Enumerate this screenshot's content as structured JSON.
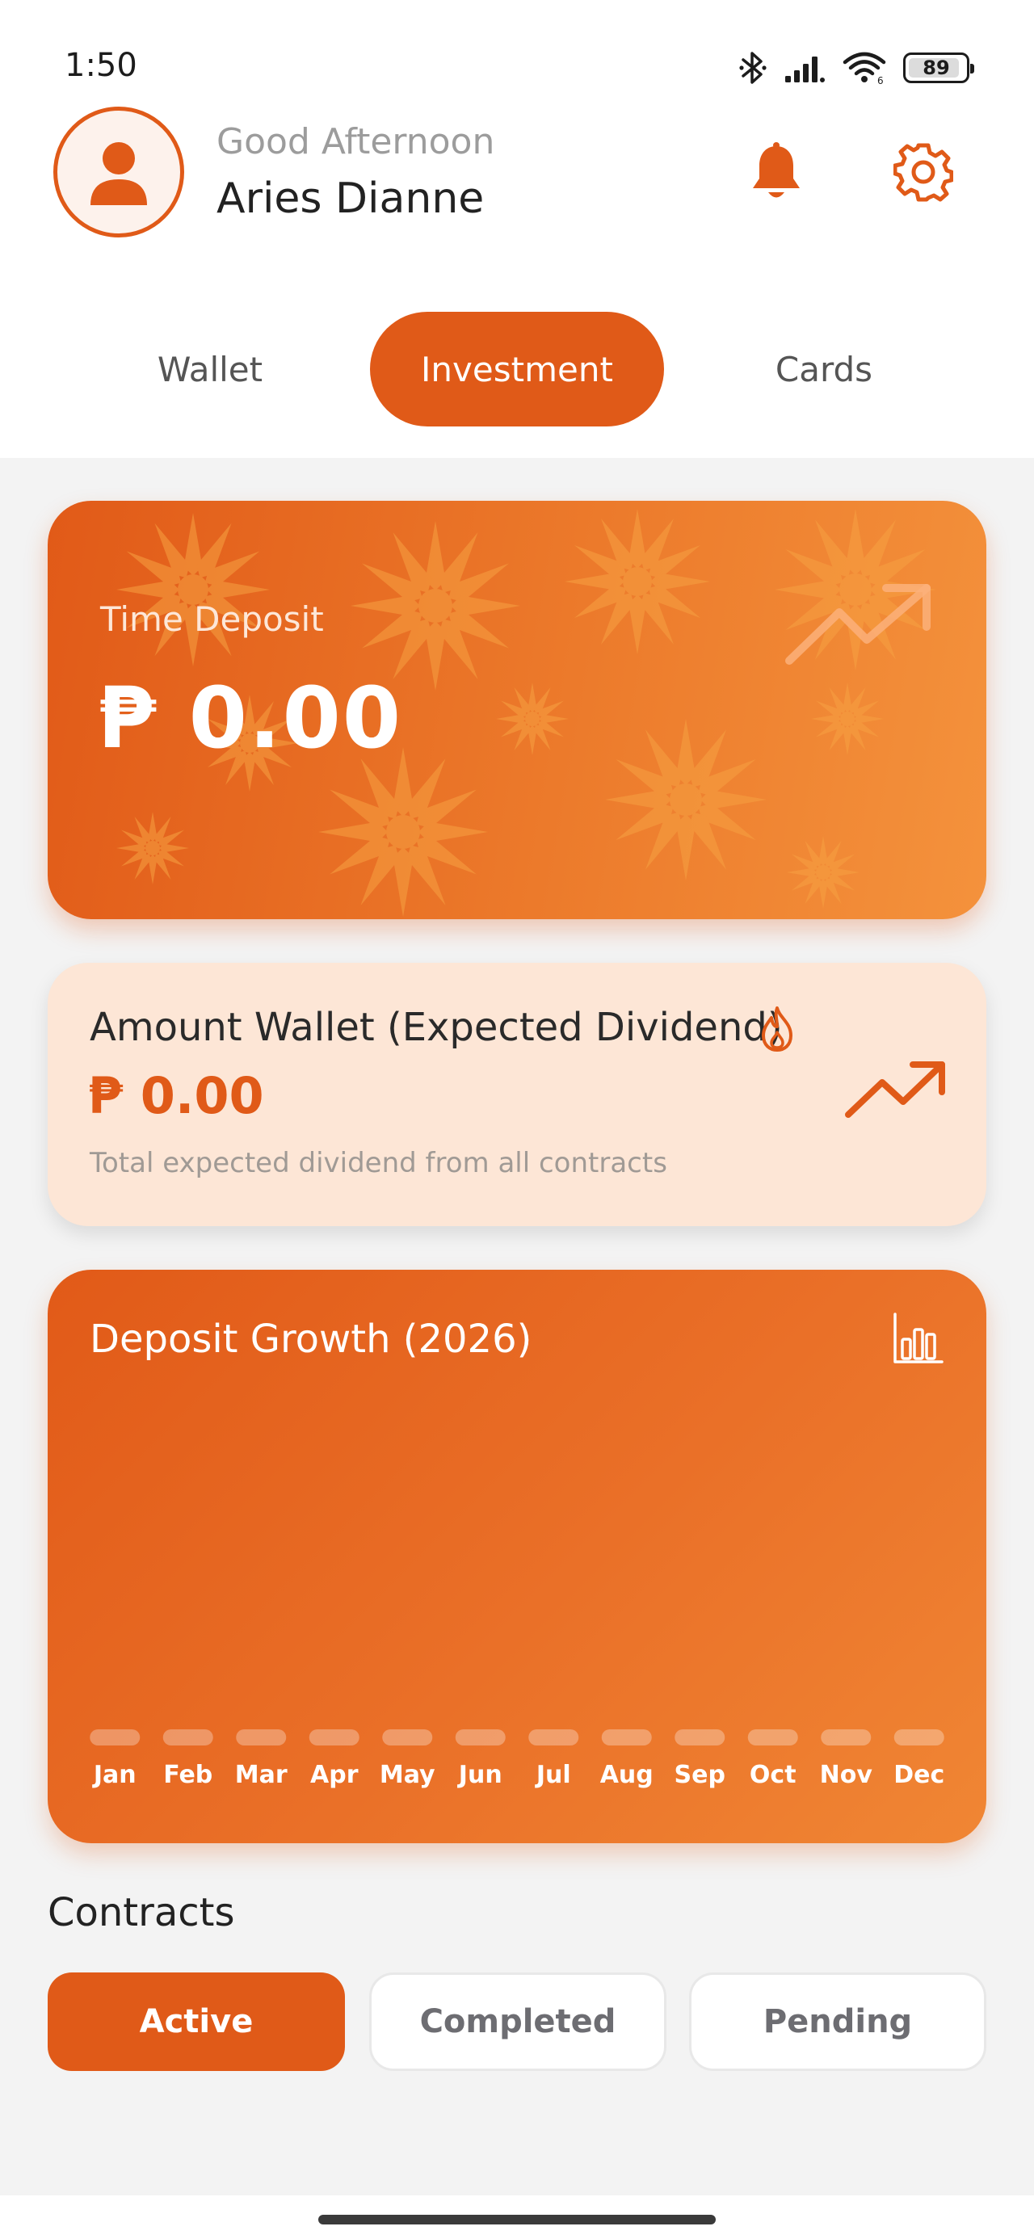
{
  "status_bar": {
    "time": "1:50",
    "battery": "89",
    "icons": [
      "bluetooth-icon",
      "signal-icon",
      "wifi-icon",
      "battery-icon"
    ]
  },
  "header": {
    "greeting": "Good Afternoon",
    "user_name": "Aries Dianne",
    "icons": [
      "user-avatar-icon",
      "bell-icon",
      "gear-icon"
    ]
  },
  "tabs": [
    {
      "label": "Wallet",
      "active": false
    },
    {
      "label": "Investment",
      "active": true
    },
    {
      "label": "Cards",
      "active": false
    }
  ],
  "time_deposit": {
    "label": "Time Deposit",
    "amount": "₱ 0.00"
  },
  "dividend": {
    "title": "Amount Wallet (Expected Dividend)",
    "amount": "₱ 0.00",
    "subtitle": "Total expected dividend from all contracts"
  },
  "growth_chart": {
    "title": "Deposit Growth (2026)"
  },
  "chart_data": {
    "type": "bar",
    "title": "Deposit Growth (2026)",
    "categories": [
      "Jan",
      "Feb",
      "Mar",
      "Apr",
      "May",
      "Jun",
      "Jul",
      "Aug",
      "Sep",
      "Oct",
      "Nov",
      "Dec"
    ],
    "values": [
      0,
      0,
      0,
      0,
      0,
      0,
      0,
      0,
      0,
      0,
      0,
      0
    ],
    "xlabel": "",
    "ylabel": "",
    "grid": false
  },
  "contracts": {
    "title": "Contracts",
    "filters": [
      {
        "label": "Active",
        "active": true
      },
      {
        "label": "Completed",
        "active": false
      },
      {
        "label": "Pending",
        "active": false
      }
    ]
  },
  "colors": {
    "accent": "#e05a18",
    "card_light": "#fde6d6",
    "background": "#f3f3f3"
  }
}
